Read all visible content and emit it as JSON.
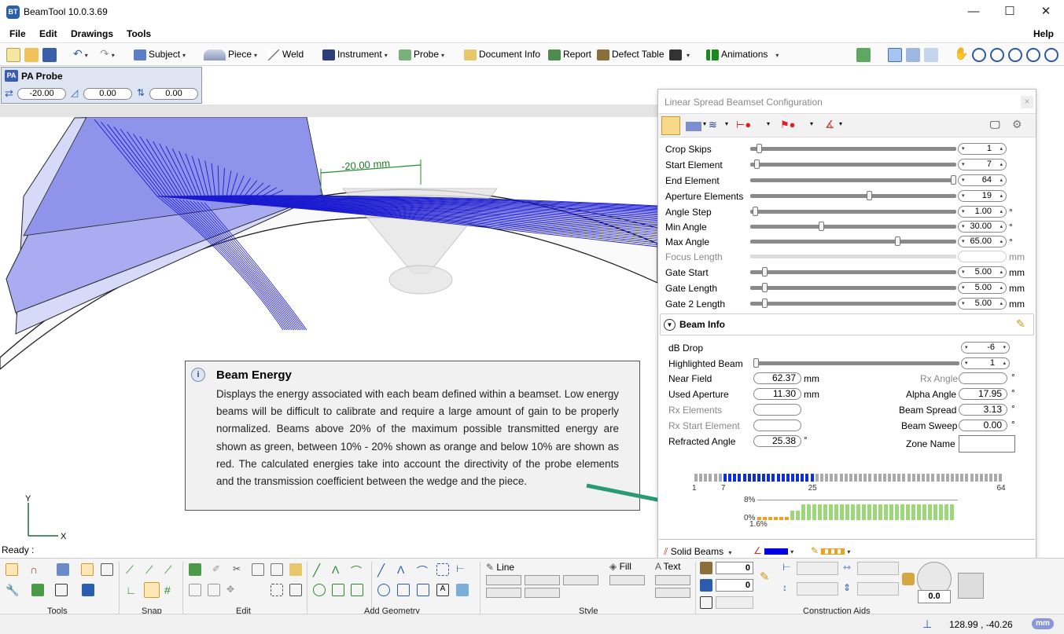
{
  "app": {
    "title": "BeamTool 10.0.3.69",
    "icon_text": "BT"
  },
  "window_controls": {
    "minimize": "—",
    "maximize": "☐",
    "close": "✕"
  },
  "menu": {
    "file": "File",
    "edit": "Edit",
    "drawings": "Drawings",
    "tools": "Tools",
    "help": "Help"
  },
  "toolbar": {
    "subject": "Subject",
    "piece": "Piece",
    "weld": "Weld",
    "instrument": "Instrument",
    "probe": "Probe",
    "document_info": "Document Info",
    "report": "Report",
    "defect_table": "Defect Table",
    "animations": "Animations"
  },
  "pa_probe": {
    "badge": "PA",
    "title": "PA Probe",
    "values": [
      "-20.00",
      "0.00",
      "0.00"
    ]
  },
  "drawing": {
    "dimension_label": "-20.00 mm",
    "axis_y": "Y",
    "axis_x": "X"
  },
  "beam_energy_tip": {
    "title": "Beam Energy",
    "body": "Displays the energy associated with each beam defined within a beamset. Low energy beams will be difficult to calibrate and require a large amount of gain to be properly normalized. Beams above 20% of the maximum possible transmitted energy are shown as green, between 10% - 20% shown as orange and below 10% are shown as red. The calculated energies take into account the directivity of the probe elements and the transmission coefficient between the wedge and the piece."
  },
  "config": {
    "title": "Linear Spread Beamset Configuration",
    "close": "×",
    "params": [
      {
        "label": "Crop Skips",
        "value": "1",
        "unit": "",
        "slider": 0.03,
        "enabled": true
      },
      {
        "label": "Start Element",
        "value": "7",
        "unit": "",
        "slider": 0.02,
        "enabled": true
      },
      {
        "label": "End Element",
        "value": "64",
        "unit": "",
        "slider": 1.0,
        "enabled": true
      },
      {
        "label": "Aperture Elements",
        "value": "19",
        "unit": "",
        "slider": 0.58,
        "enabled": true
      },
      {
        "label": "Angle Step",
        "value": "1.00",
        "unit": "°",
        "slider": 0.01,
        "enabled": true
      },
      {
        "label": "Min Angle",
        "value": "30.00",
        "unit": "°",
        "slider": 0.34,
        "enabled": true
      },
      {
        "label": "Max Angle",
        "value": "65.00",
        "unit": "°",
        "slider": 0.72,
        "enabled": true
      },
      {
        "label": "Focus Length",
        "value": "",
        "unit": "mm",
        "slider": null,
        "enabled": false
      },
      {
        "label": "Gate Start",
        "value": "5.00",
        "unit": "mm",
        "slider": 0.06,
        "enabled": true
      },
      {
        "label": "Gate Length",
        "value": "5.00",
        "unit": "mm",
        "slider": 0.06,
        "enabled": true
      },
      {
        "label": "Gate 2 Length",
        "value": "5.00",
        "unit": "mm",
        "slider": 0.06,
        "enabled": true
      }
    ],
    "beam_info": {
      "header": "Beam Info",
      "db_drop_label": "dB Drop",
      "db_drop": "-6",
      "highlighted_beam_label": "Highlighted Beam",
      "highlighted_beam": "1",
      "near_field_label": "Near Field",
      "near_field": "62.37",
      "near_field_unit": "mm",
      "used_aperture_label": "Used Aperture",
      "used_aperture": "11.30",
      "used_aperture_unit": "mm",
      "rx_elements_label": "Rx Elements",
      "rx_start_label": "Rx Start Element",
      "refracted_angle_label": "Refracted Angle",
      "refracted_angle": "25.38",
      "refracted_angle_unit": "°",
      "rx_angle_label": "Rx Angle",
      "rx_angle_unit": "°",
      "alpha_angle_label": "Alpha Angle",
      "alpha_angle": "17.95",
      "alpha_angle_unit": "°",
      "beam_spread_label": "Beam Spread",
      "beam_spread": "3.13",
      "beam_spread_unit": "°",
      "beam_sweep_label": "Beam Sweep",
      "beam_sweep": "0.00",
      "beam_sweep_unit": "°",
      "zone_name_label": "Zone Name"
    },
    "elements": {
      "ticks": [
        "1",
        "7",
        "25",
        "64"
      ],
      "total": 64,
      "active_start": 7,
      "active_end": 25
    },
    "energy": {
      "label_top": "8%",
      "label_zero": "0%",
      "label_low": "1.6%"
    },
    "footer": {
      "solid_beams": "Solid Beams"
    }
  },
  "ribbon": {
    "groups": [
      "Tools",
      "Snap",
      "Edit",
      "Add Geometry",
      "Style",
      "Construction Aids"
    ],
    "line": "Line",
    "fill": "Fill",
    "text": "Text",
    "num1": "0",
    "num2": "0",
    "dial": "0.0"
  },
  "status": {
    "ready": "Ready :",
    "coords": "128.99 , -40.26",
    "unit": "mm"
  }
}
